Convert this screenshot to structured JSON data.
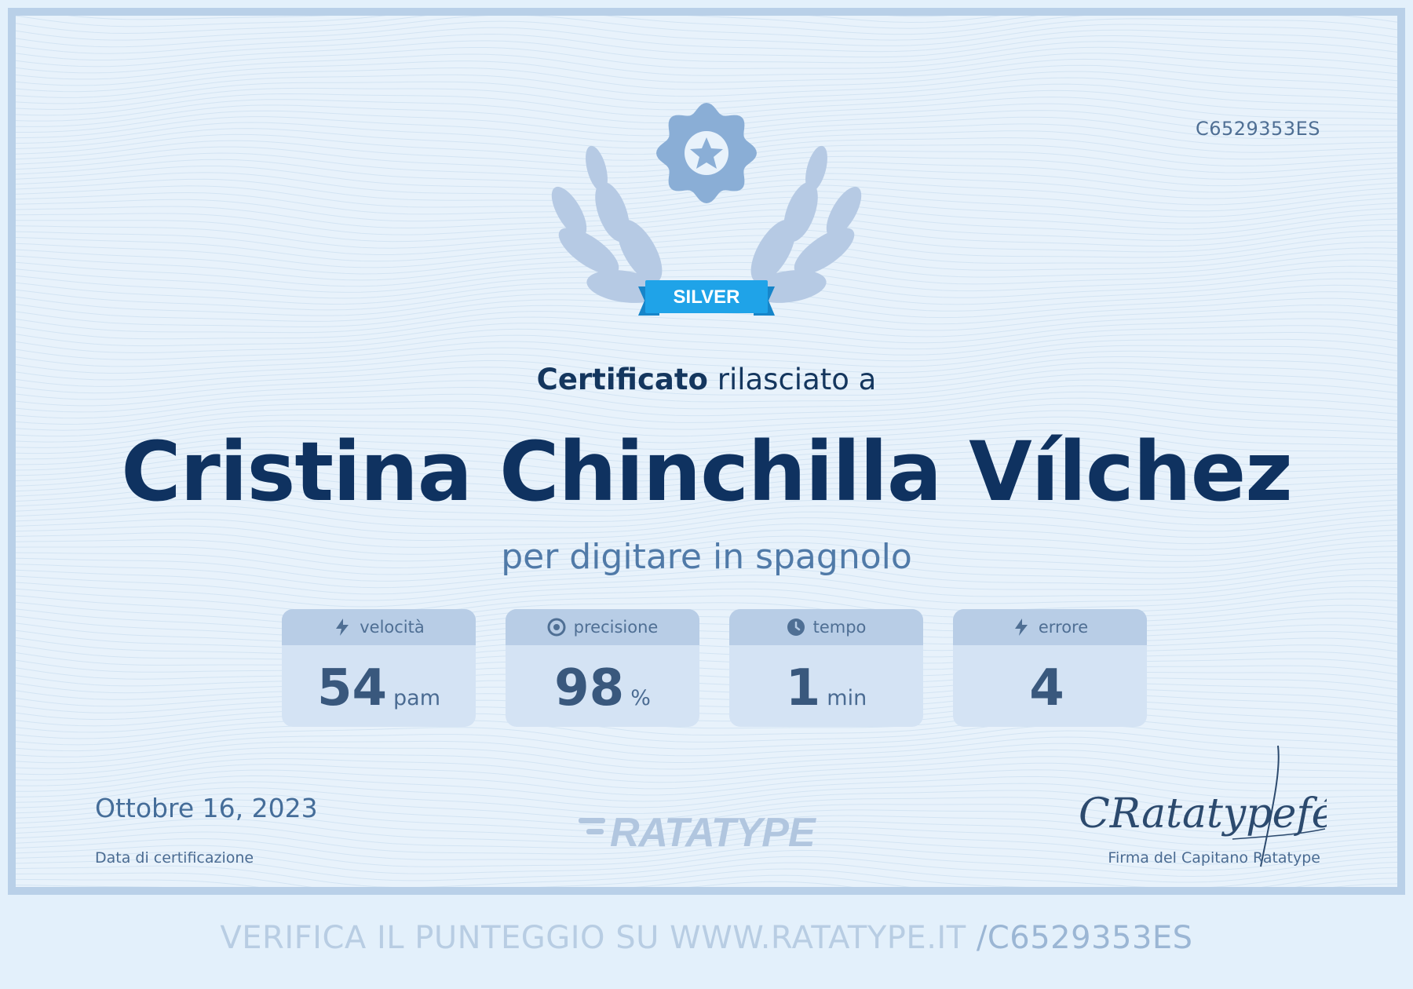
{
  "certificate": {
    "code": "C6529353ES",
    "badge_label": "SILVER",
    "heading_bold": "Certificato",
    "heading_rest": " rilasciato a",
    "recipient_name": "Cristina Chinchilla Vílchez",
    "subtitle": "per digitare in spagnolo"
  },
  "stats": [
    {
      "label": "velocità",
      "icon": "lightning-icon",
      "value": "54",
      "unit": "pam"
    },
    {
      "label": "precisione",
      "icon": "target-icon",
      "value": "98",
      "unit": "%"
    },
    {
      "label": "tempo",
      "icon": "clock-icon",
      "value": "1",
      "unit": "min"
    },
    {
      "label": "errore",
      "icon": "lightning-icon",
      "value": "4",
      "unit": ""
    }
  ],
  "footer": {
    "date": "Ottobre 16, 2023",
    "date_label": "Data di certificazione",
    "logo_text": "RATATYPE",
    "signature_text": "CRatatypefé",
    "signature_label": "Firma del Capitano Ratatype"
  },
  "verify": {
    "text": "VERIFICA IL PUNTEGGIO SU WWW.RATATYPE.IT ",
    "code": "/C6529353ES"
  },
  "colors": {
    "name": "#0f3260",
    "badge_ribbon": "#1fa3e8",
    "emblem": "#8aaed6",
    "border": "#b9d0e8"
  }
}
